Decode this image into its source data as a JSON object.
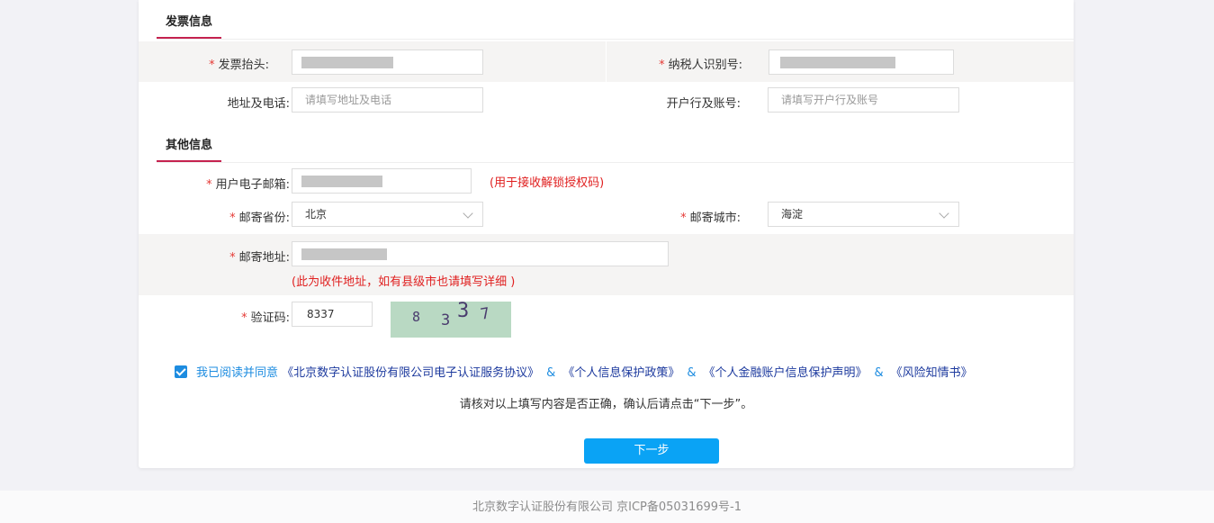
{
  "invoice": {
    "section_title": "发票信息",
    "title_label": "发票抬头:",
    "taxid_label": "纳税人识别号:",
    "address_phone_label": "地址及电话:",
    "address_phone_placeholder": "请填写地址及电话",
    "bank_label": "开户行及账号:",
    "bank_placeholder": "请填写开户行及账号"
  },
  "other": {
    "section_title": "其他信息",
    "email_label": "用户电子邮箱:",
    "email_hint": "(用于接收解锁授权码)",
    "province_label": "邮寄省份:",
    "province_value": "北京",
    "city_label": "邮寄城市:",
    "city_value": "海淀",
    "mail_address_label": "邮寄地址:",
    "mail_address_hint": "(此为收件地址，如有县级市也请填写详细 )",
    "captcha_label": "验证码:",
    "captcha_value": "8337",
    "captcha_image_chars": [
      "8",
      "3",
      "3",
      "7"
    ]
  },
  "required_mark": "*",
  "agreement": {
    "checked": true,
    "prefix": "我已阅读并同意",
    "amp": "&",
    "links": [
      "《北京数字认证股份有限公司电子认证服务协议》",
      "《个人信息保护政策》",
      "《个人金融账户信息保护声明》",
      "《风险知情书》"
    ]
  },
  "confirm_tip": "请核对以上填写内容是否正确，确认后请点击“下一步”。",
  "next_button": "下一步",
  "footer": "北京数字认证股份有限公司 京ICP备05031699号-1",
  "colors": {
    "accent_underline": "#c5224f",
    "required_red": "#e53935",
    "hint_red": "#e02020",
    "link_blue": "#1d3a9e",
    "primary_button": "#0aa3f5",
    "checkbox_blue": "#1d8ce0"
  }
}
